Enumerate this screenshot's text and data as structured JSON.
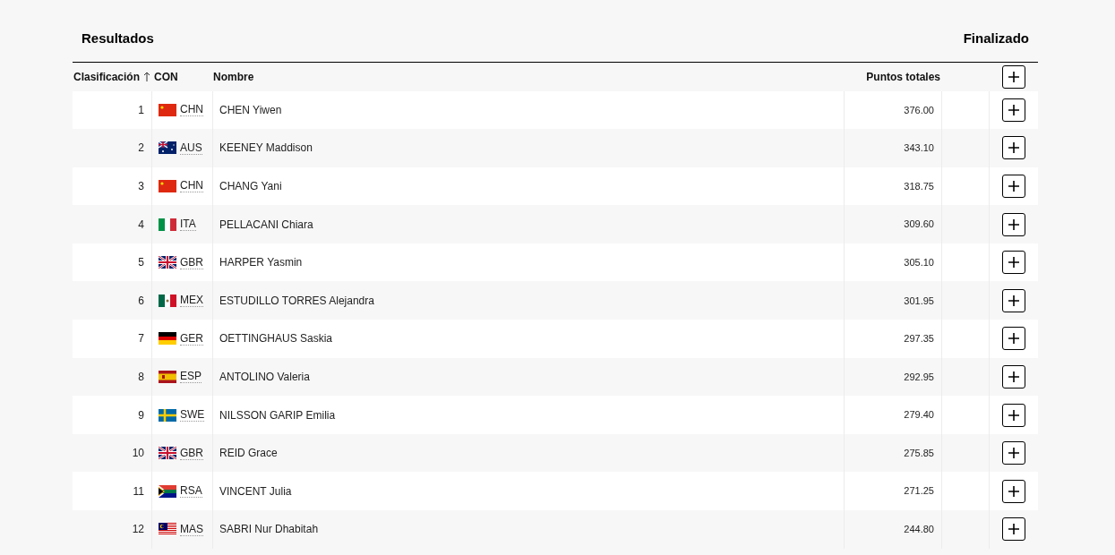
{
  "header": {
    "title": "Resultados",
    "status": "Finalizado"
  },
  "table": {
    "columns": [
      {
        "label": "Clasificación",
        "sorted": true
      },
      {
        "label": "CON",
        "sorted": false
      },
      {
        "label": "Nombre",
        "sorted": false
      },
      {
        "label": "Puntos totales",
        "sorted": false
      }
    ],
    "rows": [
      {
        "rank": "1",
        "kind": "chn",
        "noc": "CHN",
        "name": "CHEN Yiwen",
        "points": "376.00"
      },
      {
        "rank": "2",
        "kind": "aus",
        "noc": "AUS",
        "name": "KEENEY Maddison",
        "points": "343.10"
      },
      {
        "rank": "3",
        "kind": "chn",
        "noc": "CHN",
        "name": "CHANG Yani",
        "points": "318.75"
      },
      {
        "rank": "4",
        "kind": "ita",
        "noc": "ITA",
        "name": "PELLACANI Chiara",
        "points": "309.60"
      },
      {
        "rank": "5",
        "kind": "gbr",
        "noc": "GBR",
        "name": "HARPER Yasmin",
        "points": "305.10"
      },
      {
        "rank": "6",
        "kind": "mex",
        "noc": "MEX",
        "name": "ESTUDILLO TORRES Alejandra",
        "points": "301.95"
      },
      {
        "rank": "7",
        "kind": "ger",
        "noc": "GER",
        "name": "OETTINGHAUS Saskia",
        "points": "297.35"
      },
      {
        "rank": "8",
        "kind": "esp",
        "noc": "ESP",
        "name": "ANTOLINO Valeria",
        "points": "292.95"
      },
      {
        "rank": "9",
        "kind": "swe",
        "noc": "SWE",
        "name": "NILSSON GARIP Emilia",
        "points": "279.40"
      },
      {
        "rank": "10",
        "kind": "gbr",
        "noc": "GBR",
        "name": "REID Grace",
        "points": "275.85"
      },
      {
        "rank": "11",
        "kind": "rsa",
        "noc": "RSA",
        "name": "VINCENT Julia",
        "points": "271.25"
      },
      {
        "rank": "12",
        "kind": "mas",
        "noc": "MAS",
        "name": "SABRI Nur Dhabitah",
        "points": "244.80"
      }
    ]
  }
}
